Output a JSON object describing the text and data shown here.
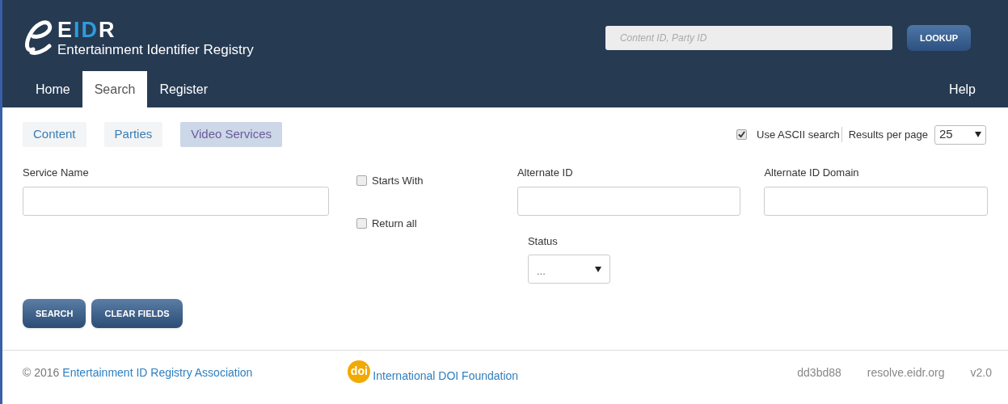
{
  "header": {
    "logo_mark": "EIDR",
    "logo_subtitle": "Entertainment Identifier Registry",
    "lookup": {
      "placeholder": "Content ID, Party ID",
      "button": "LOOKUP"
    }
  },
  "nav": {
    "items": [
      {
        "label": "Home",
        "selected": false
      },
      {
        "label": "Search",
        "selected": true
      },
      {
        "label": "Register",
        "selected": false
      }
    ],
    "help": "Help"
  },
  "search_tabs": [
    {
      "label": "Content",
      "selected": false
    },
    {
      "label": "Parties",
      "selected": false
    },
    {
      "label": "Video Services",
      "selected": true
    }
  ],
  "options": {
    "ascii": {
      "label": "Use ASCII search",
      "checked": true
    },
    "results_label": "Results per page",
    "results_value": "25"
  },
  "form": {
    "service_name": {
      "label": "Service Name"
    },
    "starts_with": {
      "label": "Starts With",
      "checked": false
    },
    "return_all": {
      "label": "Return all",
      "checked": false
    },
    "alternate_id": {
      "label": "Alternate ID"
    },
    "alternate_id_domain": {
      "label": "Alternate ID Domain"
    },
    "status": {
      "label": "Status",
      "value": "..."
    }
  },
  "buttons": [
    "SEARCH",
    "CLEAR FIELDS"
  ],
  "footer": {
    "copyright": "© 2016",
    "association": "Entertainment ID Registry Association",
    "doi_logo": "doi",
    "doi_link": "International DOI Foundation",
    "build": "dd3bd88",
    "resolver": "resolve.eidr.org",
    "version": "v2.0"
  }
}
